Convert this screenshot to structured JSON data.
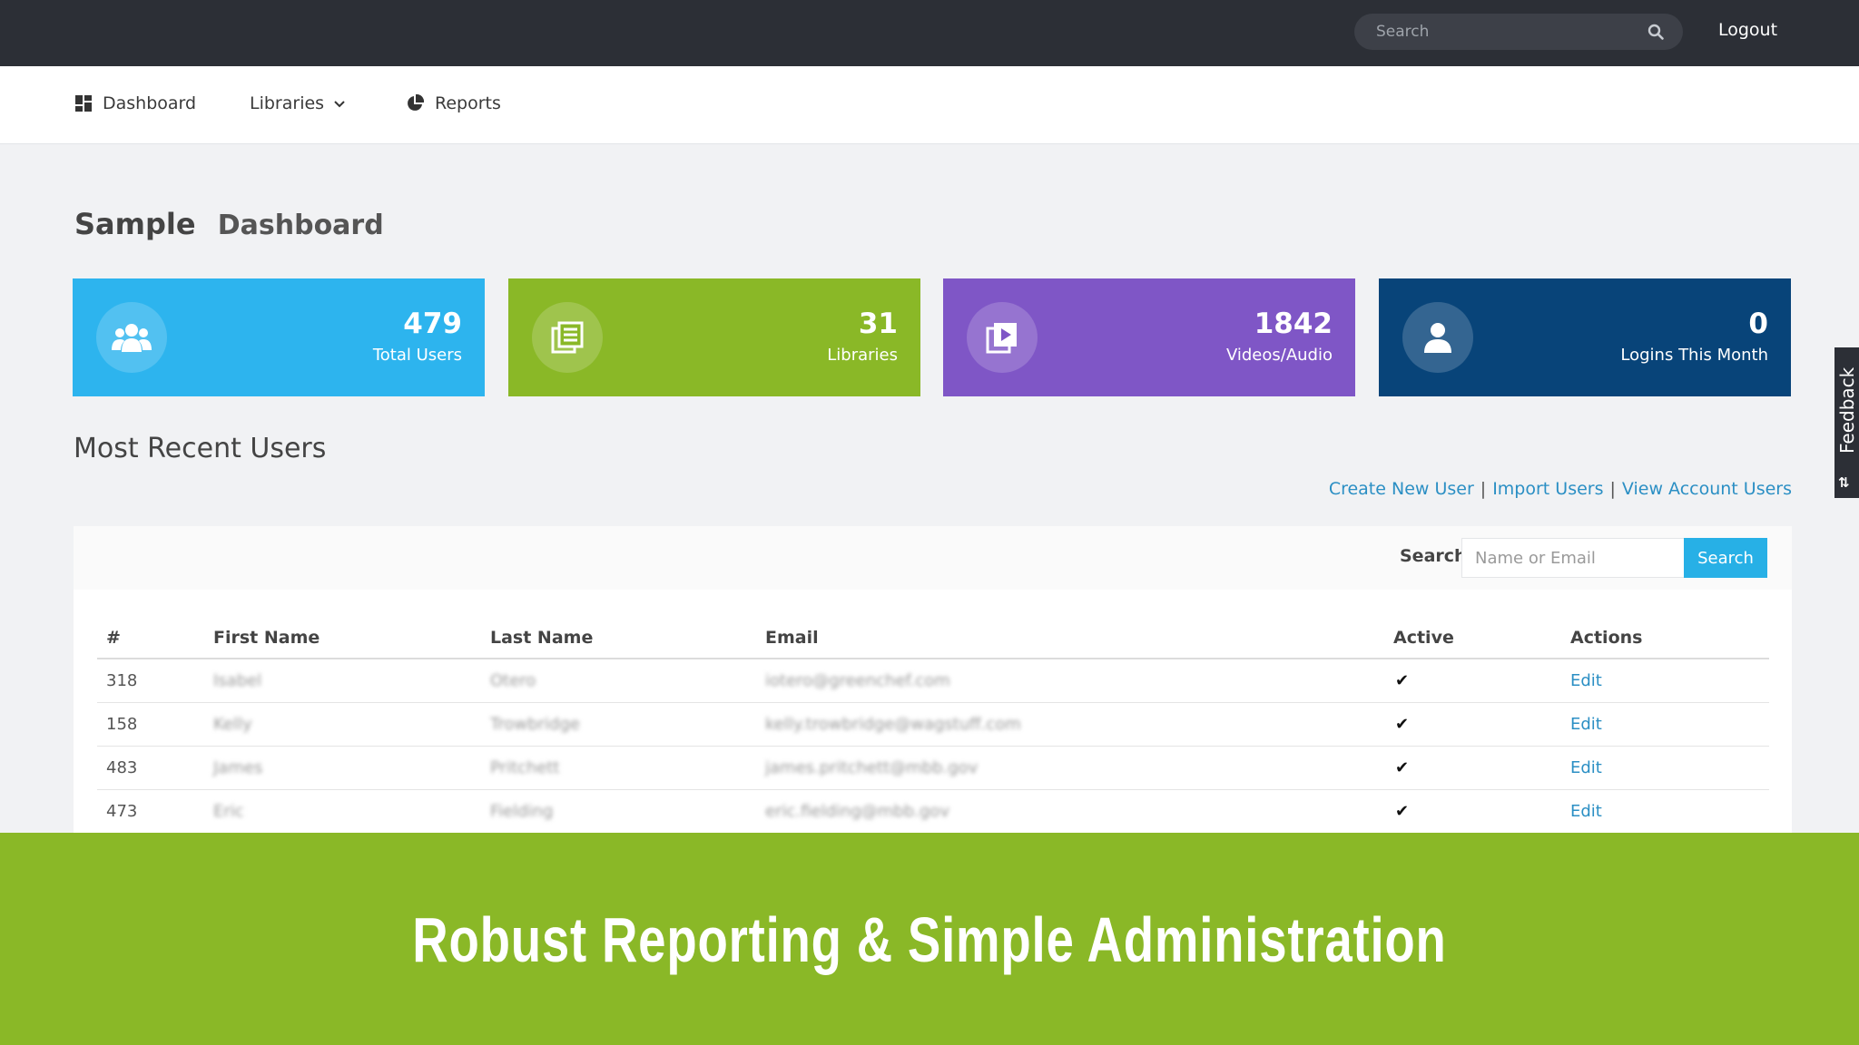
{
  "topbar": {
    "search_placeholder": "Search",
    "logout": "Logout"
  },
  "nav": {
    "dashboard": "Dashboard",
    "libraries": "Libraries",
    "reports": "Reports"
  },
  "page": {
    "title_part1": "Sample",
    "title_part2": "Dashboard"
  },
  "stats": [
    {
      "value": "479",
      "label": "Total Users",
      "color": "#2db4ee",
      "icon": "users-icon"
    },
    {
      "value": "31",
      "label": "Libraries",
      "color": "#8ab827",
      "icon": "library-icon"
    },
    {
      "value": "1842",
      "label": "Videos/Audio",
      "color": "#7f56c6",
      "icon": "video-icon"
    },
    {
      "value": "0",
      "label": "Logins This Month",
      "color": "#084479",
      "icon": "user-icon"
    }
  ],
  "section": {
    "title": "Most Recent Users",
    "links": [
      "Create New User",
      "Import Users",
      "View Account Users"
    ]
  },
  "user_search": {
    "label": "Search",
    "placeholder": "Name or Email",
    "button": "Search"
  },
  "table": {
    "headers": [
      "#",
      "First Name",
      "Last Name",
      "Email",
      "Active",
      "Actions"
    ],
    "rows": [
      {
        "id": "318",
        "first": "Isabel",
        "last": "Otero",
        "email": "iotero@greenchef.com",
        "active": "✔",
        "action": "Edit"
      },
      {
        "id": "158",
        "first": "Kelly",
        "last": "Trowbridge",
        "email": "kelly.trowbridge@wagstuff.com",
        "active": "✔",
        "action": "Edit"
      },
      {
        "id": "483",
        "first": "James",
        "last": "Pritchett",
        "email": "james.pritchett@mbb.gov",
        "active": "✔",
        "action": "Edit"
      },
      {
        "id": "473",
        "first": "Eric",
        "last": "Fielding",
        "email": "eric.fielding@mbb.gov",
        "active": "✔",
        "action": "Edit"
      }
    ]
  },
  "feedback": {
    "label": "Feedback",
    "icon_text": "⇅"
  },
  "banner": {
    "text": "Robust Reporting & Simple Administration",
    "color": "#8ab827"
  }
}
